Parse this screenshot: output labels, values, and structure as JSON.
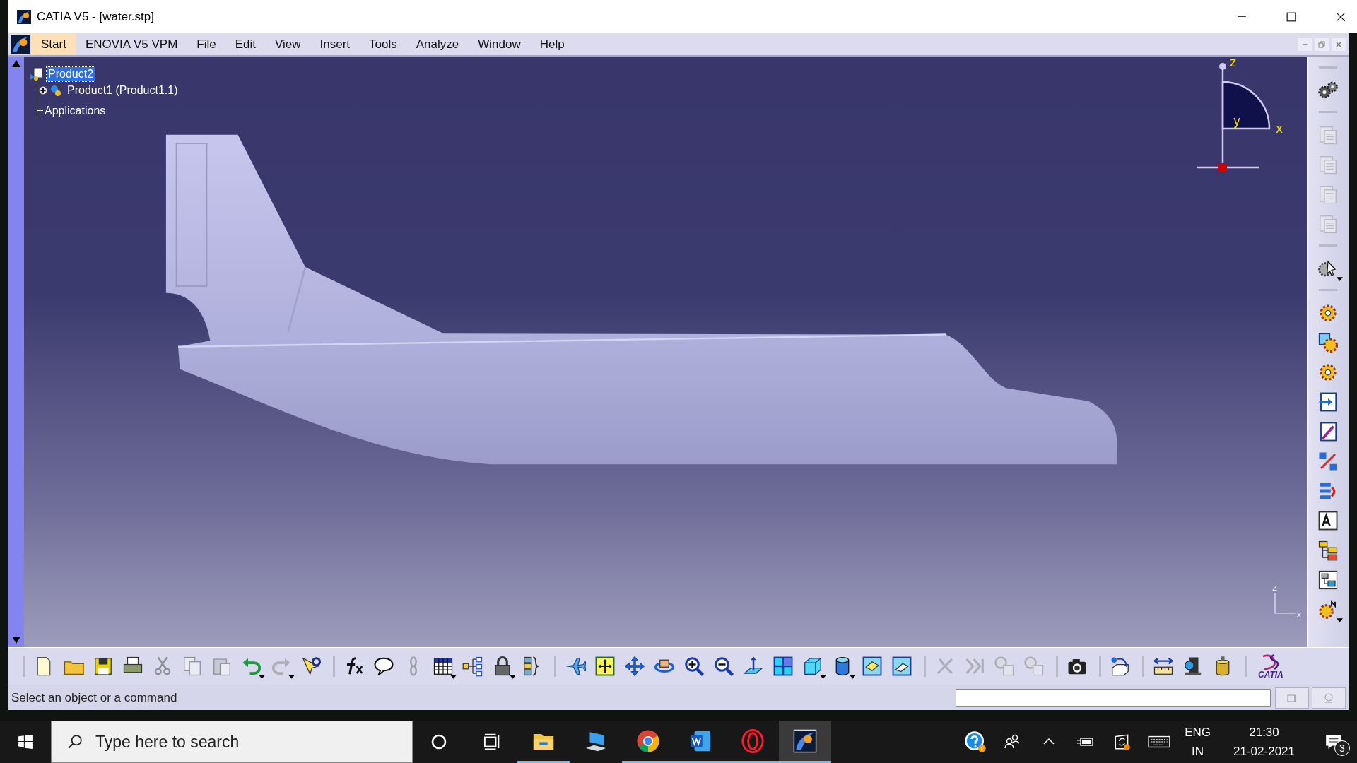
{
  "window": {
    "title": "CATIA V5 - [water.stp]"
  },
  "menu": [
    {
      "label": "Start",
      "selected": true
    },
    {
      "label": "ENOVIA V5 VPM",
      "selected": false
    },
    {
      "label": "File",
      "selected": false
    },
    {
      "label": "Edit",
      "selected": false
    },
    {
      "label": "View",
      "selected": false
    },
    {
      "label": "Insert",
      "selected": false
    },
    {
      "label": "Tools",
      "selected": false
    },
    {
      "label": "Analyze",
      "selected": false
    },
    {
      "label": "Window",
      "selected": false
    },
    {
      "label": "Help",
      "selected": false
    }
  ],
  "tree": {
    "label": "Product2",
    "selected": true,
    "children": [
      {
        "label": "Product1 (Product1.1)",
        "selected": false,
        "expanded": false
      },
      {
        "label": "Applications",
        "selected": false
      }
    ]
  },
  "compass": {
    "z": "z",
    "y": "y",
    "x": "x"
  },
  "axis_indicator": {
    "z": "z",
    "x": "x"
  },
  "right_toolbar": [
    [
      {
        "disabled": false,
        "dropdown": false
      }
    ],
    [
      {
        "disabled": true,
        "dropdown": false
      },
      {
        "disabled": true,
        "dropdown": false
      },
      {
        "disabled": true,
        "dropdown": false
      },
      {
        "disabled": true,
        "dropdown": false
      }
    ],
    [
      {
        "disabled": false,
        "dropdown": true
      }
    ],
    [
      {
        "disabled": false,
        "dropdown": false
      },
      {
        "disabled": false,
        "dropdown": false
      },
      {
        "disabled": false,
        "dropdown": false
      },
      {
        "disabled": false,
        "dropdown": false
      },
      {
        "disabled": false,
        "dropdown": false
      },
      {
        "disabled": false,
        "dropdown": false
      },
      {
        "disabled": false,
        "dropdown": false
      },
      {
        "disabled": false,
        "dropdown": false
      },
      {
        "disabled": false,
        "dropdown": false
      },
      {
        "disabled": false,
        "dropdown": false
      },
      {
        "disabled": false,
        "dropdown": true
      }
    ]
  ],
  "bottom_toolbar": [
    [
      {
        "disabled": false,
        "dropdown": false
      },
      {
        "disabled": false,
        "dropdown": false
      },
      {
        "disabled": false,
        "dropdown": false
      },
      {
        "disabled": false,
        "dropdown": false
      },
      {
        "disabled": true,
        "dropdown": false
      },
      {
        "disabled": true,
        "dropdown": false
      },
      {
        "disabled": true,
        "dropdown": false
      },
      {
        "disabled": false,
        "dropdown": true
      },
      {
        "disabled": true,
        "dropdown": true
      },
      {
        "disabled": false,
        "dropdown": false
      }
    ],
    [
      {
        "disabled": false,
        "dropdown": false
      },
      {
        "disabled": false,
        "dropdown": false
      },
      {
        "disabled": true,
        "dropdown": false
      },
      {
        "disabled": false,
        "dropdown": true
      },
      {
        "disabled": false,
        "dropdown": false
      },
      {
        "disabled": false,
        "dropdown": true
      },
      {
        "disabled": false,
        "dropdown": false
      }
    ],
    [
      {
        "disabled": false,
        "dropdown": false
      },
      {
        "disabled": false,
        "dropdown": false
      },
      {
        "disabled": false,
        "dropdown": false
      },
      {
        "disabled": false,
        "dropdown": false
      },
      {
        "disabled": false,
        "dropdown": false
      },
      {
        "disabled": false,
        "dropdown": false
      },
      {
        "disabled": false,
        "dropdown": false
      },
      {
        "disabled": false,
        "dropdown": false
      },
      {
        "disabled": false,
        "dropdown": true
      },
      {
        "disabled": false,
        "dropdown": true
      },
      {
        "disabled": false,
        "dropdown": false
      },
      {
        "disabled": false,
        "dropdown": false
      }
    ],
    [
      {
        "disabled": true,
        "dropdown": false
      },
      {
        "disabled": true,
        "dropdown": false
      },
      {
        "disabled": true,
        "dropdown": false
      },
      {
        "disabled": true,
        "dropdown": false
      }
    ],
    [
      {
        "disabled": false,
        "dropdown": false
      }
    ],
    [
      {
        "disabled": false,
        "dropdown": false
      }
    ],
    [
      {
        "disabled": false,
        "dropdown": false
      },
      {
        "disabled": false,
        "dropdown": false
      },
      {
        "disabled": false,
        "dropdown": false
      }
    ]
  ],
  "logo": "CATIA",
  "status_bar": {
    "message": "Select an object or a command"
  },
  "taskbar": {
    "search": {
      "placeholder": "Type here to search"
    },
    "apps": [
      {
        "running": true,
        "selected": false
      },
      {
        "running": false,
        "selected": false
      },
      {
        "running": true,
        "selected": false
      },
      {
        "running": true,
        "selected": false
      },
      {
        "running": true,
        "selected": false
      },
      {
        "running": true,
        "selected": true
      }
    ],
    "tray": {
      "language": "ENG",
      "region": "IN",
      "time": "21:30",
      "date": "21-02-2021",
      "notifications": "3"
    }
  }
}
